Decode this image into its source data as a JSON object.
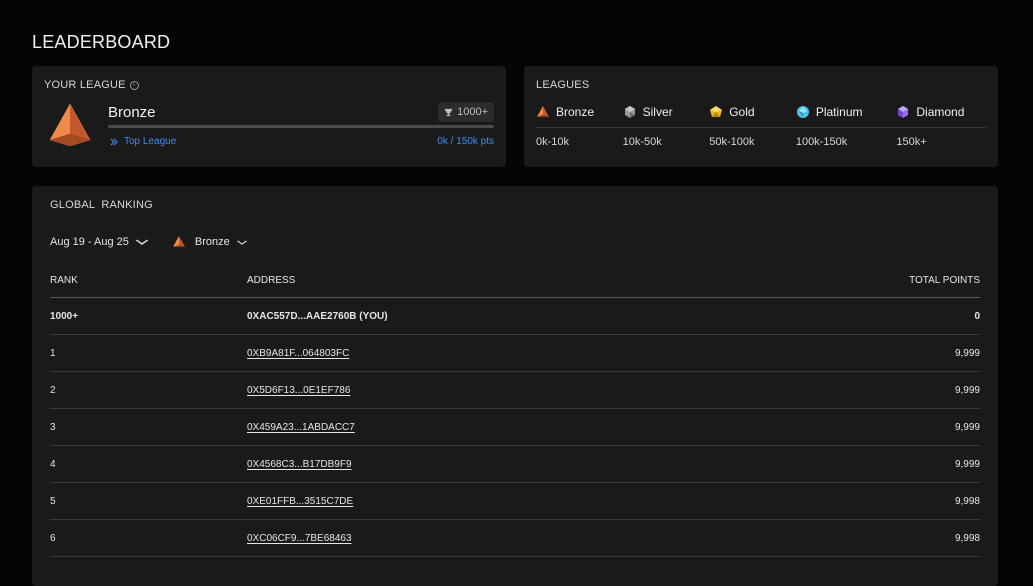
{
  "page": {
    "title": "LEADERBOARD"
  },
  "your_league": {
    "title": "YOUR LEAGUE",
    "league_name": "Bronze",
    "rank_badge": "1000+",
    "top_league_link": "Top League",
    "points_progress": "0k / 150k pts",
    "progress_fraction": 0.0,
    "accent_color": "#e07a3a",
    "link_color": "#3d8cf0"
  },
  "leagues": {
    "title": "LEAGUES",
    "items": [
      {
        "name": "Bronze",
        "range": "0k-10k",
        "icon": "bronze-pyramid-icon",
        "color": "#e07a3a"
      },
      {
        "name": "Silver",
        "range": "10k-50k",
        "icon": "silver-gem-icon",
        "color": "#a8a8a8"
      },
      {
        "name": "Gold",
        "range": "50k-100k",
        "icon": "gold-gem-icon",
        "color": "#e8b424"
      },
      {
        "name": "Platinum",
        "range": "100k-150k",
        "icon": "platinum-gem-icon",
        "color": "#4cc3e8"
      },
      {
        "name": "Diamond",
        "range": "150k+",
        "icon": "diamond-gem-icon",
        "color": "#9b6cf0"
      }
    ]
  },
  "global_ranking": {
    "title": "GLOBAL  RANKING",
    "date_filter": "Aug 19 - Aug 25",
    "league_filter": "Bronze",
    "columns": {
      "rank": "RANK",
      "address": "ADDRESS",
      "points": "TOTAL POINTS"
    },
    "rows": [
      {
        "rank": "1000+",
        "address": "0XAC557D...AAE2760B (YOU)",
        "points": "0",
        "is_you": true
      },
      {
        "rank": "1",
        "address": "0XB9A81F...064803FC",
        "points": "9,999"
      },
      {
        "rank": "2",
        "address": "0X5D6F13...0E1EF786",
        "points": "9,999"
      },
      {
        "rank": "3",
        "address": "0X459A23...1ABDACC7",
        "points": "9,999"
      },
      {
        "rank": "4",
        "address": "0X4568C3...B17DB9F9",
        "points": "9,999"
      },
      {
        "rank": "5",
        "address": "0XE01FFB...3515C7DE",
        "points": "9,998"
      },
      {
        "rank": "6",
        "address": "0XC06CF9...7BE68463",
        "points": "9,998"
      }
    ]
  }
}
